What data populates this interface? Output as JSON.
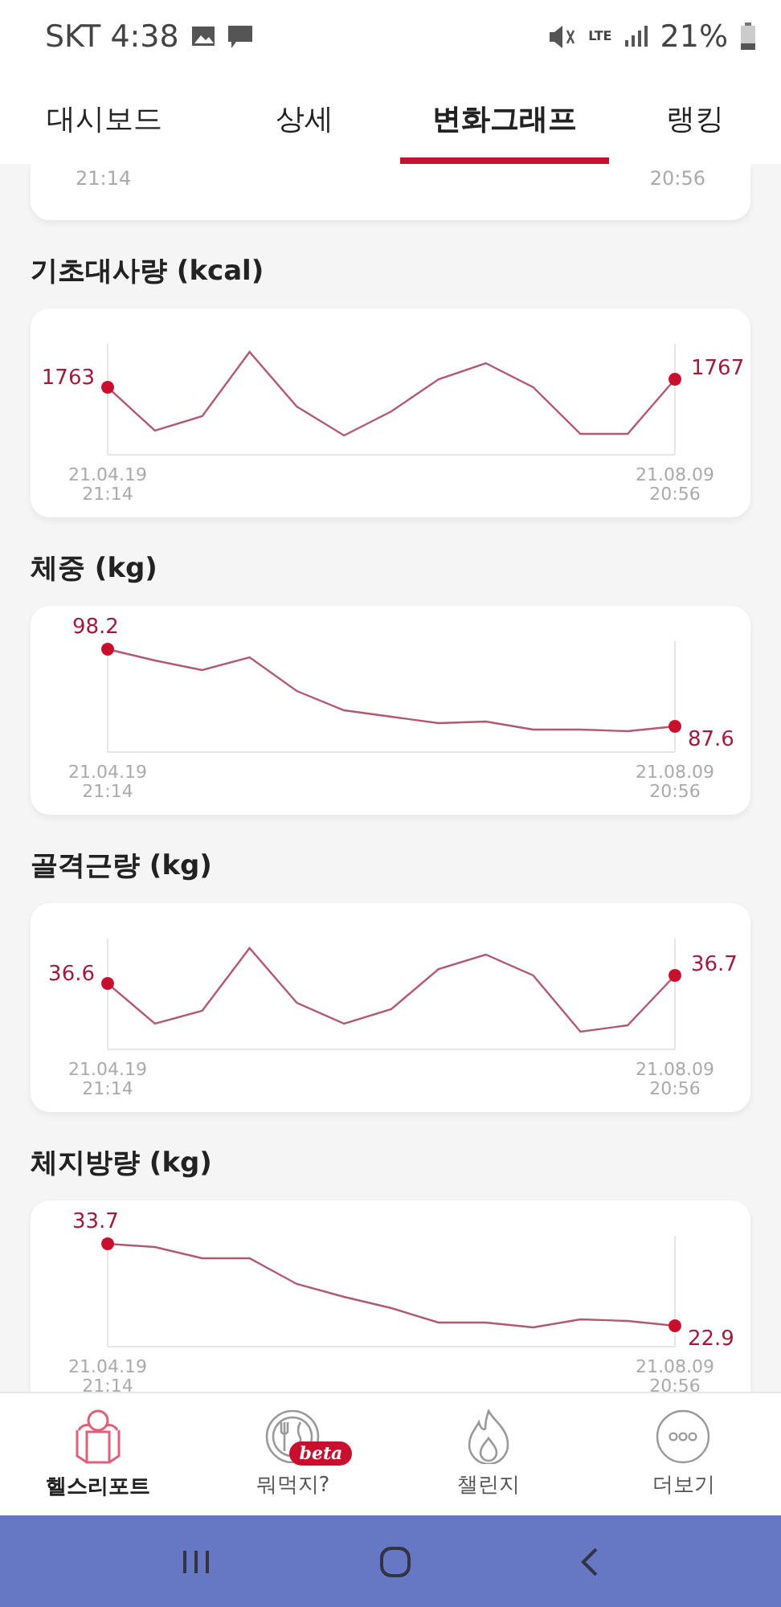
{
  "status_bar": {
    "carrier_time": "SKT 4:38",
    "network": "LTE",
    "battery": "21%"
  },
  "tabs": [
    {
      "label": "대시보드",
      "selected": false
    },
    {
      "label": "상세",
      "selected": false
    },
    {
      "label": "변화그래프",
      "selected": true
    },
    {
      "label": "랭킹",
      "selected": false
    }
  ],
  "partial_card": {
    "start_time": "21:14",
    "end_time": "20:56"
  },
  "charts": [
    {
      "title": "기초대사량 (kcal)",
      "start_value": "1763",
      "end_value": "1767",
      "start_date": "21.04.19",
      "start_time": "21:14",
      "end_date": "21.08.09",
      "end_time": "20:56"
    },
    {
      "title": "체중 (kg)",
      "start_value": "98.2",
      "end_value": "87.6",
      "start_date": "21.04.19",
      "start_time": "21:14",
      "end_date": "21.08.09",
      "end_time": "20:56"
    },
    {
      "title": "골격근량 (kg)",
      "start_value": "36.6",
      "end_value": "36.7",
      "start_date": "21.04.19",
      "start_time": "21:14",
      "end_date": "21.08.09",
      "end_time": "20:56"
    },
    {
      "title": "체지방량 (kg)",
      "start_value": "33.7",
      "end_value": "22.9",
      "start_date": "21.04.19",
      "start_time": "21:14",
      "end_date": "21.08.09",
      "end_time": "20:56"
    }
  ],
  "bottom_nav": [
    {
      "label": "헬스리포트",
      "selected": true,
      "kind": "report"
    },
    {
      "label": "뭐먹지?",
      "selected": false,
      "kind": "food",
      "badge": "beta"
    },
    {
      "label": "챌린지",
      "selected": false,
      "kind": "challenge"
    },
    {
      "label": "더보기",
      "selected": false,
      "kind": "more"
    }
  ]
}
